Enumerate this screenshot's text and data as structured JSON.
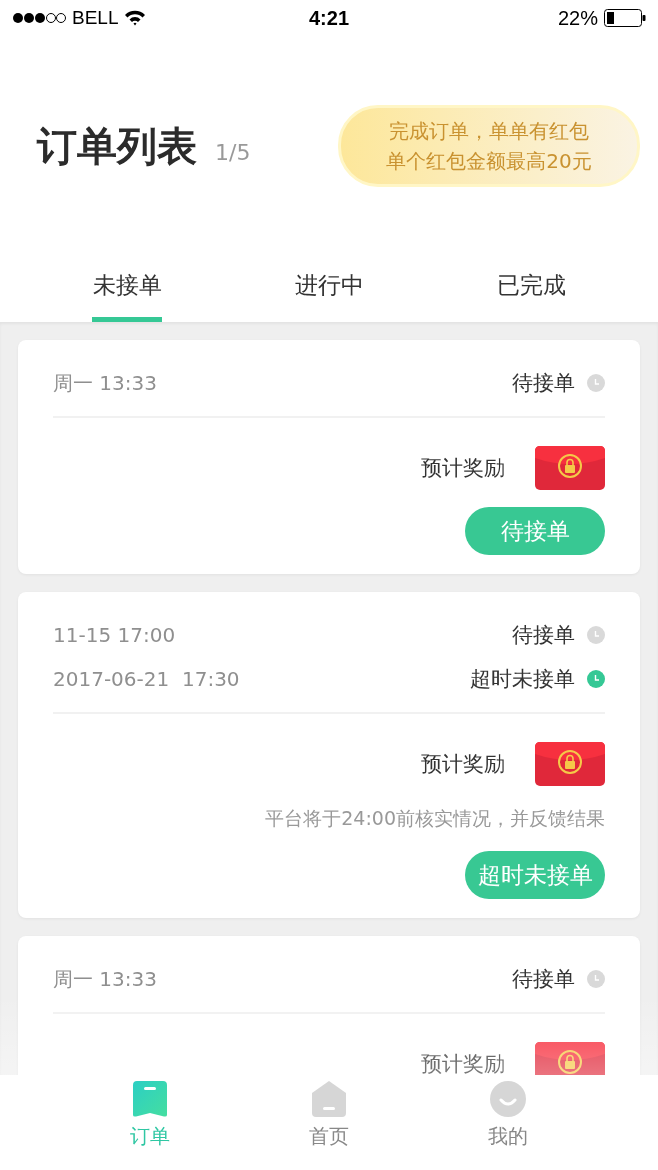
{
  "status_bar": {
    "carrier": "BELL",
    "time": "4:21",
    "battery": "22%"
  },
  "header": {
    "title": "订单列表",
    "page": "1/5",
    "promo": [
      "完成订单，单单有红包",
      "单个红包金额最高20元"
    ]
  },
  "tabs": [
    {
      "label": "未接单",
      "selected": true
    },
    {
      "label": "进行中",
      "selected": false
    },
    {
      "label": "已完成",
      "selected": false
    }
  ],
  "orders": [
    {
      "times": [
        {
          "time": "周一 13:33",
          "status": "待接单",
          "color": "#d9d9d9"
        }
      ],
      "reward_label": "预计奖励",
      "action": "待接单"
    },
    {
      "times": [
        {
          "time": "11-15 17:00",
          "status": "待接单",
          "color": "#d9d9d9"
        },
        {
          "time": "2017-06-21  17:30",
          "status": "超时未接单",
          "color": "#35c895"
        }
      ],
      "reward_label": "预计奖励",
      "note": "平台将于24:00前核实情况，并反馈结果",
      "action": "超时未接单"
    },
    {
      "times": [
        {
          "time": "周一 13:33",
          "status": "待接单",
          "color": "#d9d9d9"
        }
      ],
      "reward_label": "预计奖励"
    }
  ],
  "nav": [
    {
      "label": "订单",
      "kind": "orders",
      "selected": true
    },
    {
      "label": "首页",
      "kind": "home",
      "selected": false
    },
    {
      "label": "我的",
      "kind": "me",
      "selected": false
    }
  ]
}
